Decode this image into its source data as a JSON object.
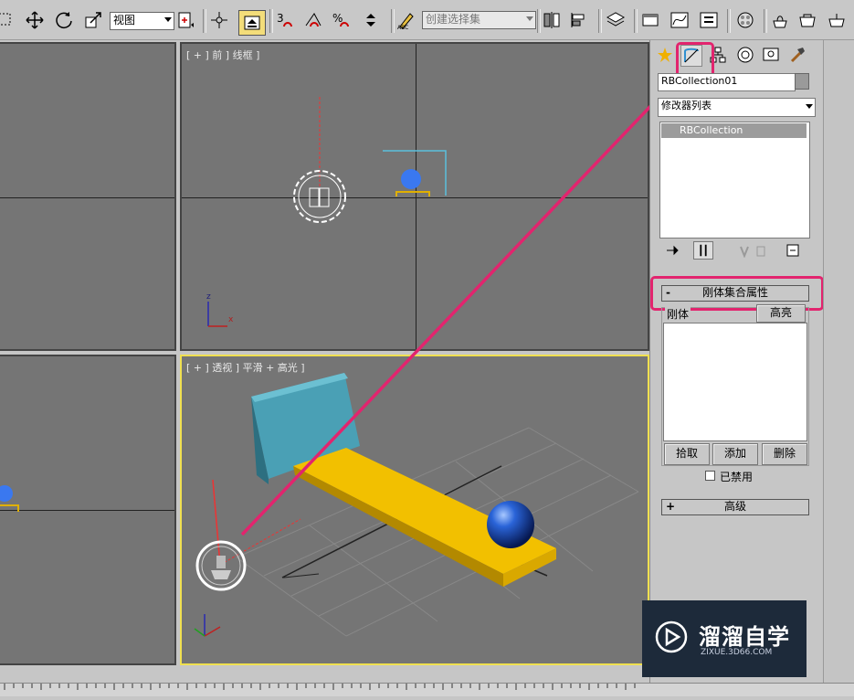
{
  "toolbar": {
    "view_dropdown": "视图",
    "selection_set_placeholder": "创建选择集"
  },
  "viewports": {
    "front_label": "[ + ] 前 ] 线框 ]",
    "perspective_label": "[ + ] 透视 ] 平滑 + 高光 ]",
    "axis_z": "z",
    "axis_x": "x"
  },
  "panel": {
    "object_name": "RBCollection01",
    "modifier_list": "修改器列表",
    "stack_item": "RBCollection",
    "rollout_props": "刚体集合属性",
    "rollout_props_sign": "-",
    "rigid_body_label": "刚体",
    "highlight_button": "高亮",
    "pick_button": "拾取",
    "add_button": "添加",
    "delete_button": "删除",
    "disabled_label": "已禁用",
    "rollout_advanced": "高级",
    "rollout_advanced_sign": "+"
  },
  "watermark": {
    "title": "溜溜自学",
    "subtitle": "ZIXUE.3D66.COM"
  },
  "colors": {
    "highlight": "#e2246e",
    "viewport_bg": "#757575",
    "active_border": "#f0e050",
    "plank": "#d9a800",
    "box": "#4aa0b5",
    "sphere": "#2060d0"
  }
}
